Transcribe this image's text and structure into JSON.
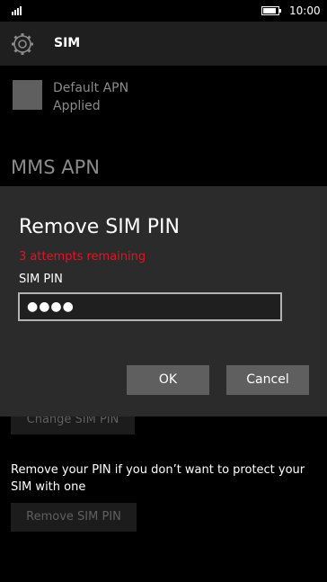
{
  "status_bar": {
    "time": "10:00",
    "battery_level": 0.9,
    "signal_bars": 4
  },
  "header": {
    "icon": "gear-icon",
    "title": "SIM"
  },
  "apn": {
    "name": "Default APN",
    "status": "Applied"
  },
  "section": {
    "title": "MMS APN"
  },
  "dialog": {
    "title": "Remove SIM PIN",
    "error": "3 attempts remaining",
    "field_label": "SIM PIN",
    "pin_value": "●●●●",
    "ok_label": "OK",
    "cancel_label": "Cancel"
  },
  "settings": {
    "change_pin_label": "Change SIM PIN",
    "remove_description": "Remove your PIN if you don’t want to protect your SIM with one",
    "remove_pin_label": "Remove SIM PIN"
  },
  "colors": {
    "background": "#000000",
    "header": "#1f1f1f",
    "dialog": "#2b2b2b",
    "button": "#5f5f5f",
    "error": "#e81123"
  }
}
